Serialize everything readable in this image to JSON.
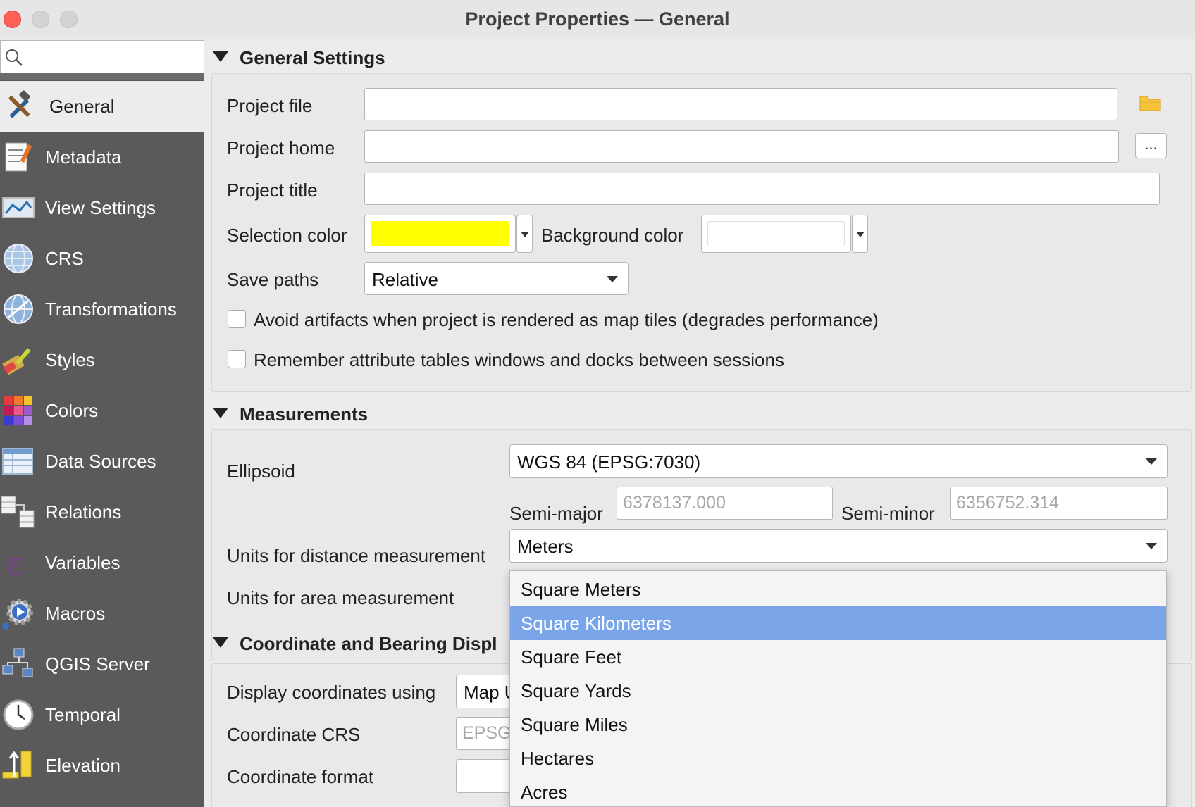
{
  "window": {
    "title": "Project Properties — General"
  },
  "sidebar": {
    "search_placeholder": "",
    "items": [
      {
        "label": "General",
        "icon": "hammer-wrench-icon",
        "selected": true
      },
      {
        "label": "Metadata",
        "icon": "document-pencil-icon"
      },
      {
        "label": "View Settings",
        "icon": "map-view-icon"
      },
      {
        "label": "CRS",
        "icon": "globe-icon"
      },
      {
        "label": "Transformations",
        "icon": "globe-transform-icon"
      },
      {
        "label": "Styles",
        "icon": "paint-brush-icon"
      },
      {
        "label": "Colors",
        "icon": "color-grid-icon"
      },
      {
        "label": "Data Sources",
        "icon": "table-icon"
      },
      {
        "label": "Relations",
        "icon": "relations-icon"
      },
      {
        "label": "Variables",
        "icon": "epsilon-icon"
      },
      {
        "label": "Macros",
        "icon": "gear-play-icon"
      },
      {
        "label": "QGIS Server",
        "icon": "server-network-icon"
      },
      {
        "label": "Temporal",
        "icon": "clock-icon"
      },
      {
        "label": "Elevation",
        "icon": "elevation-icon"
      }
    ]
  },
  "general_settings": {
    "header": "General Settings",
    "project_file_label": "Project file",
    "project_file_value": "",
    "project_home_label": "Project home",
    "project_home_value": "",
    "browse_label": "...",
    "project_title_label": "Project title",
    "project_title_value": "",
    "selection_color_label": "Selection color",
    "selection_color": "#ffff00",
    "background_color_label": "Background color",
    "background_color": "#ffffff",
    "save_paths_label": "Save paths",
    "save_paths_value": "Relative",
    "avoid_artifacts_label": "Avoid artifacts when project is rendered as map tiles (degrades performance)",
    "avoid_artifacts_checked": false,
    "remember_tables_label": "Remember attribute tables windows and docks between sessions",
    "remember_tables_checked": false
  },
  "measurements": {
    "header": "Measurements",
    "ellipsoid_label": "Ellipsoid",
    "ellipsoid_value": "WGS 84 (EPSG:7030)",
    "semi_major_label": "Semi-major",
    "semi_major_value": "6378137.000",
    "semi_minor_label": "Semi-minor",
    "semi_minor_value": "6356752.314",
    "distance_units_label": "Units for distance measurement",
    "distance_units_value": "Meters",
    "area_units_label": "Units for area measurement"
  },
  "coordinate_section": {
    "header": "Coordinate and Bearing Displ",
    "display_using_label": "Display coordinates using",
    "display_using_value": "Map U",
    "coordinate_crs_label": "Coordinate CRS",
    "coordinate_crs_value": "EPSG",
    "coordinate_format_label": "Coordinate format",
    "coordinate_format_value": ""
  },
  "area_units_popup": {
    "options": [
      "Square Meters",
      "Square Kilometers",
      "Square Feet",
      "Square Yards",
      "Square Miles",
      "Hectares",
      "Acres"
    ],
    "highlighted": "Square Kilometers"
  },
  "colors": {
    "highlight": "#7aa6e9",
    "sidebar_bg": "#5a5a5a",
    "folder": "#f6c33a"
  }
}
